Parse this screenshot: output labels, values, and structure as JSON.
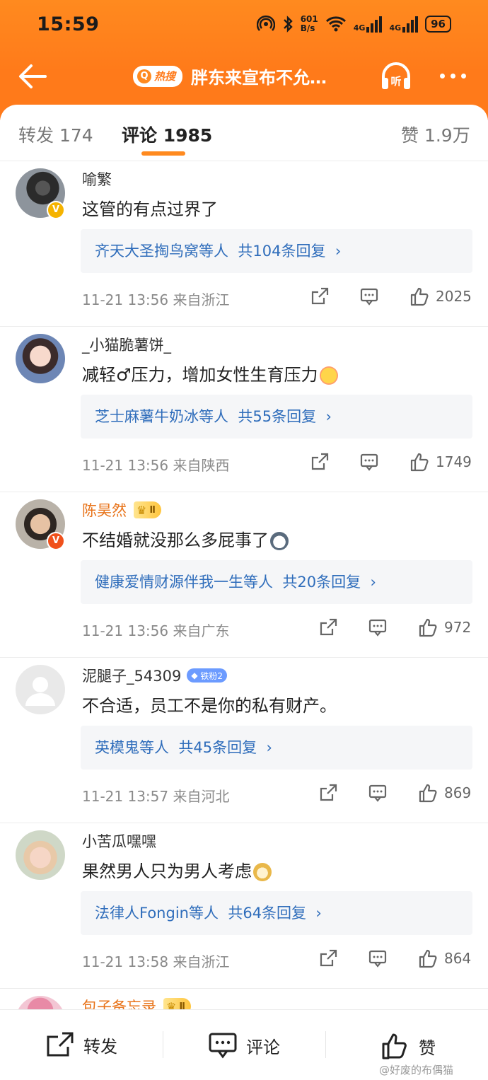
{
  "status_bar": {
    "time": "15:59",
    "net_speed_top": "601",
    "net_speed_bottom": "B/s",
    "signal1": "4G",
    "signal2": "4G",
    "battery": "96"
  },
  "nav": {
    "hot_badge": "热搜",
    "title": "胖东来宣布不允…",
    "listen_icon": "headphones-icon",
    "more_icon": "more-dots-icon"
  },
  "tabs": {
    "repost": "转发 174",
    "comments": "评论 1985",
    "likes": "赞 1.9万"
  },
  "comments": [
    {
      "user": "喻繁",
      "text": "这管的有点过界了",
      "reply_users": "齐天大圣掏鸟窝等人",
      "reply_count": "共104条回复",
      "meta": "11-21 13:56 来自浙江",
      "likes": "2025",
      "badge": "V",
      "badge_color": "#f5b300"
    },
    {
      "user": "_小猫脆薯饼_",
      "text": "减轻♂压力，增加女性生育压力",
      "reply_users": "芝士麻薯牛奶冰等人",
      "reply_count": "共55条回复",
      "meta": "11-21 13:56 来自陕西",
      "likes": "1749"
    },
    {
      "user": "陈昊然",
      "level": "Ⅱ",
      "text": "不结婚就没那么多屁事了",
      "reply_users": "健康爱情财源伴我一生等人",
      "reply_count": "共20条回复",
      "meta": "11-21 13:56 来自广东",
      "likes": "972",
      "badge": "V",
      "badge_color": "#f0511c"
    },
    {
      "user": "泥腿子_54309",
      "fan_badge": "铁粉2",
      "text": "不合适，员工不是你的私有财产。",
      "reply_users": "英模鬼等人",
      "reply_count": "共45条回复",
      "meta": "11-21 13:57 来自河北",
      "likes": "869"
    },
    {
      "user": "小苦瓜嘿嘿",
      "text": "果然男人只为男人考虑",
      "reply_users": "法律人Fongin等人",
      "reply_count": "共64条回复",
      "meta": "11-21 13:58 来自浙江",
      "likes": "864"
    }
  ],
  "partial_comment": {
    "user": "包子备忘录",
    "level": "Ⅱ"
  },
  "bottom_bar": {
    "repost": "转发",
    "comment": "评论",
    "like": "赞"
  },
  "watermark": "@好废的布偶猫",
  "colors": {
    "header": "#ff7a1a",
    "link": "#2f6dbb",
    "vip_name": "#e8741b"
  }
}
